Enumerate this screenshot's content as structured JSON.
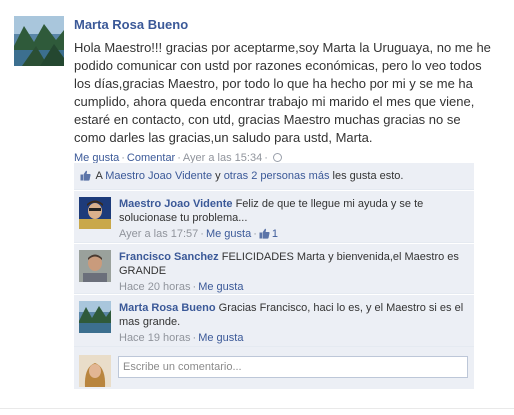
{
  "post": {
    "author": "Marta Rosa Bueno",
    "message": "Hola Maestro!!! gracias por aceptarme,soy Marta la Uruguaya, no me he podido comunicar con ustd por razones económicas, pero lo veo todos los días,gracias Maestro, por todo lo que ha hecho por mi y se me ha cumplido, ahora queda encontrar trabajo mi marido el mes que viene, estaré en contacto, con utd, gracias Maestro muchas gracias no se como darles las gracias,un saludo para ustd, Marta.",
    "like_label": "Me gusta",
    "comment_label": "Comentar",
    "timestamp": "Ayer a las 15:34",
    "audience_icon": "globe-icon"
  },
  "likes": {
    "prefix": "A",
    "first_liker": "Maestro Joao Vidente",
    "conjunction": "y",
    "others": "otras 2 personas más",
    "suffix": "les gusta esto."
  },
  "comments": [
    {
      "author": "Maestro Joao Vidente",
      "text": "Feliz de que te llegue mi ayuda y se te solucionase tu problema...",
      "time": "Ayer a las 17:57",
      "like_label": "Me gusta",
      "like_count": "1"
    },
    {
      "author": "Francisco Sanchez",
      "text": "FELICIDADES Marta y bienvenida,el Maestro es GRANDE",
      "time": "Hace 20 horas",
      "like_label": "Me gusta"
    },
    {
      "author": "Marta Rosa Bueno",
      "text": "Gracias Francisco, haci lo es, y el Maestro si es el mas grande.",
      "time": "Hace 19 horas",
      "like_label": "Me gusta"
    }
  ],
  "composer": {
    "placeholder": "Escribe un comentario..."
  },
  "colors": {
    "link": "#3b5998",
    "ufi_background": "#eceff5",
    "meta_gray": "#90949c"
  }
}
